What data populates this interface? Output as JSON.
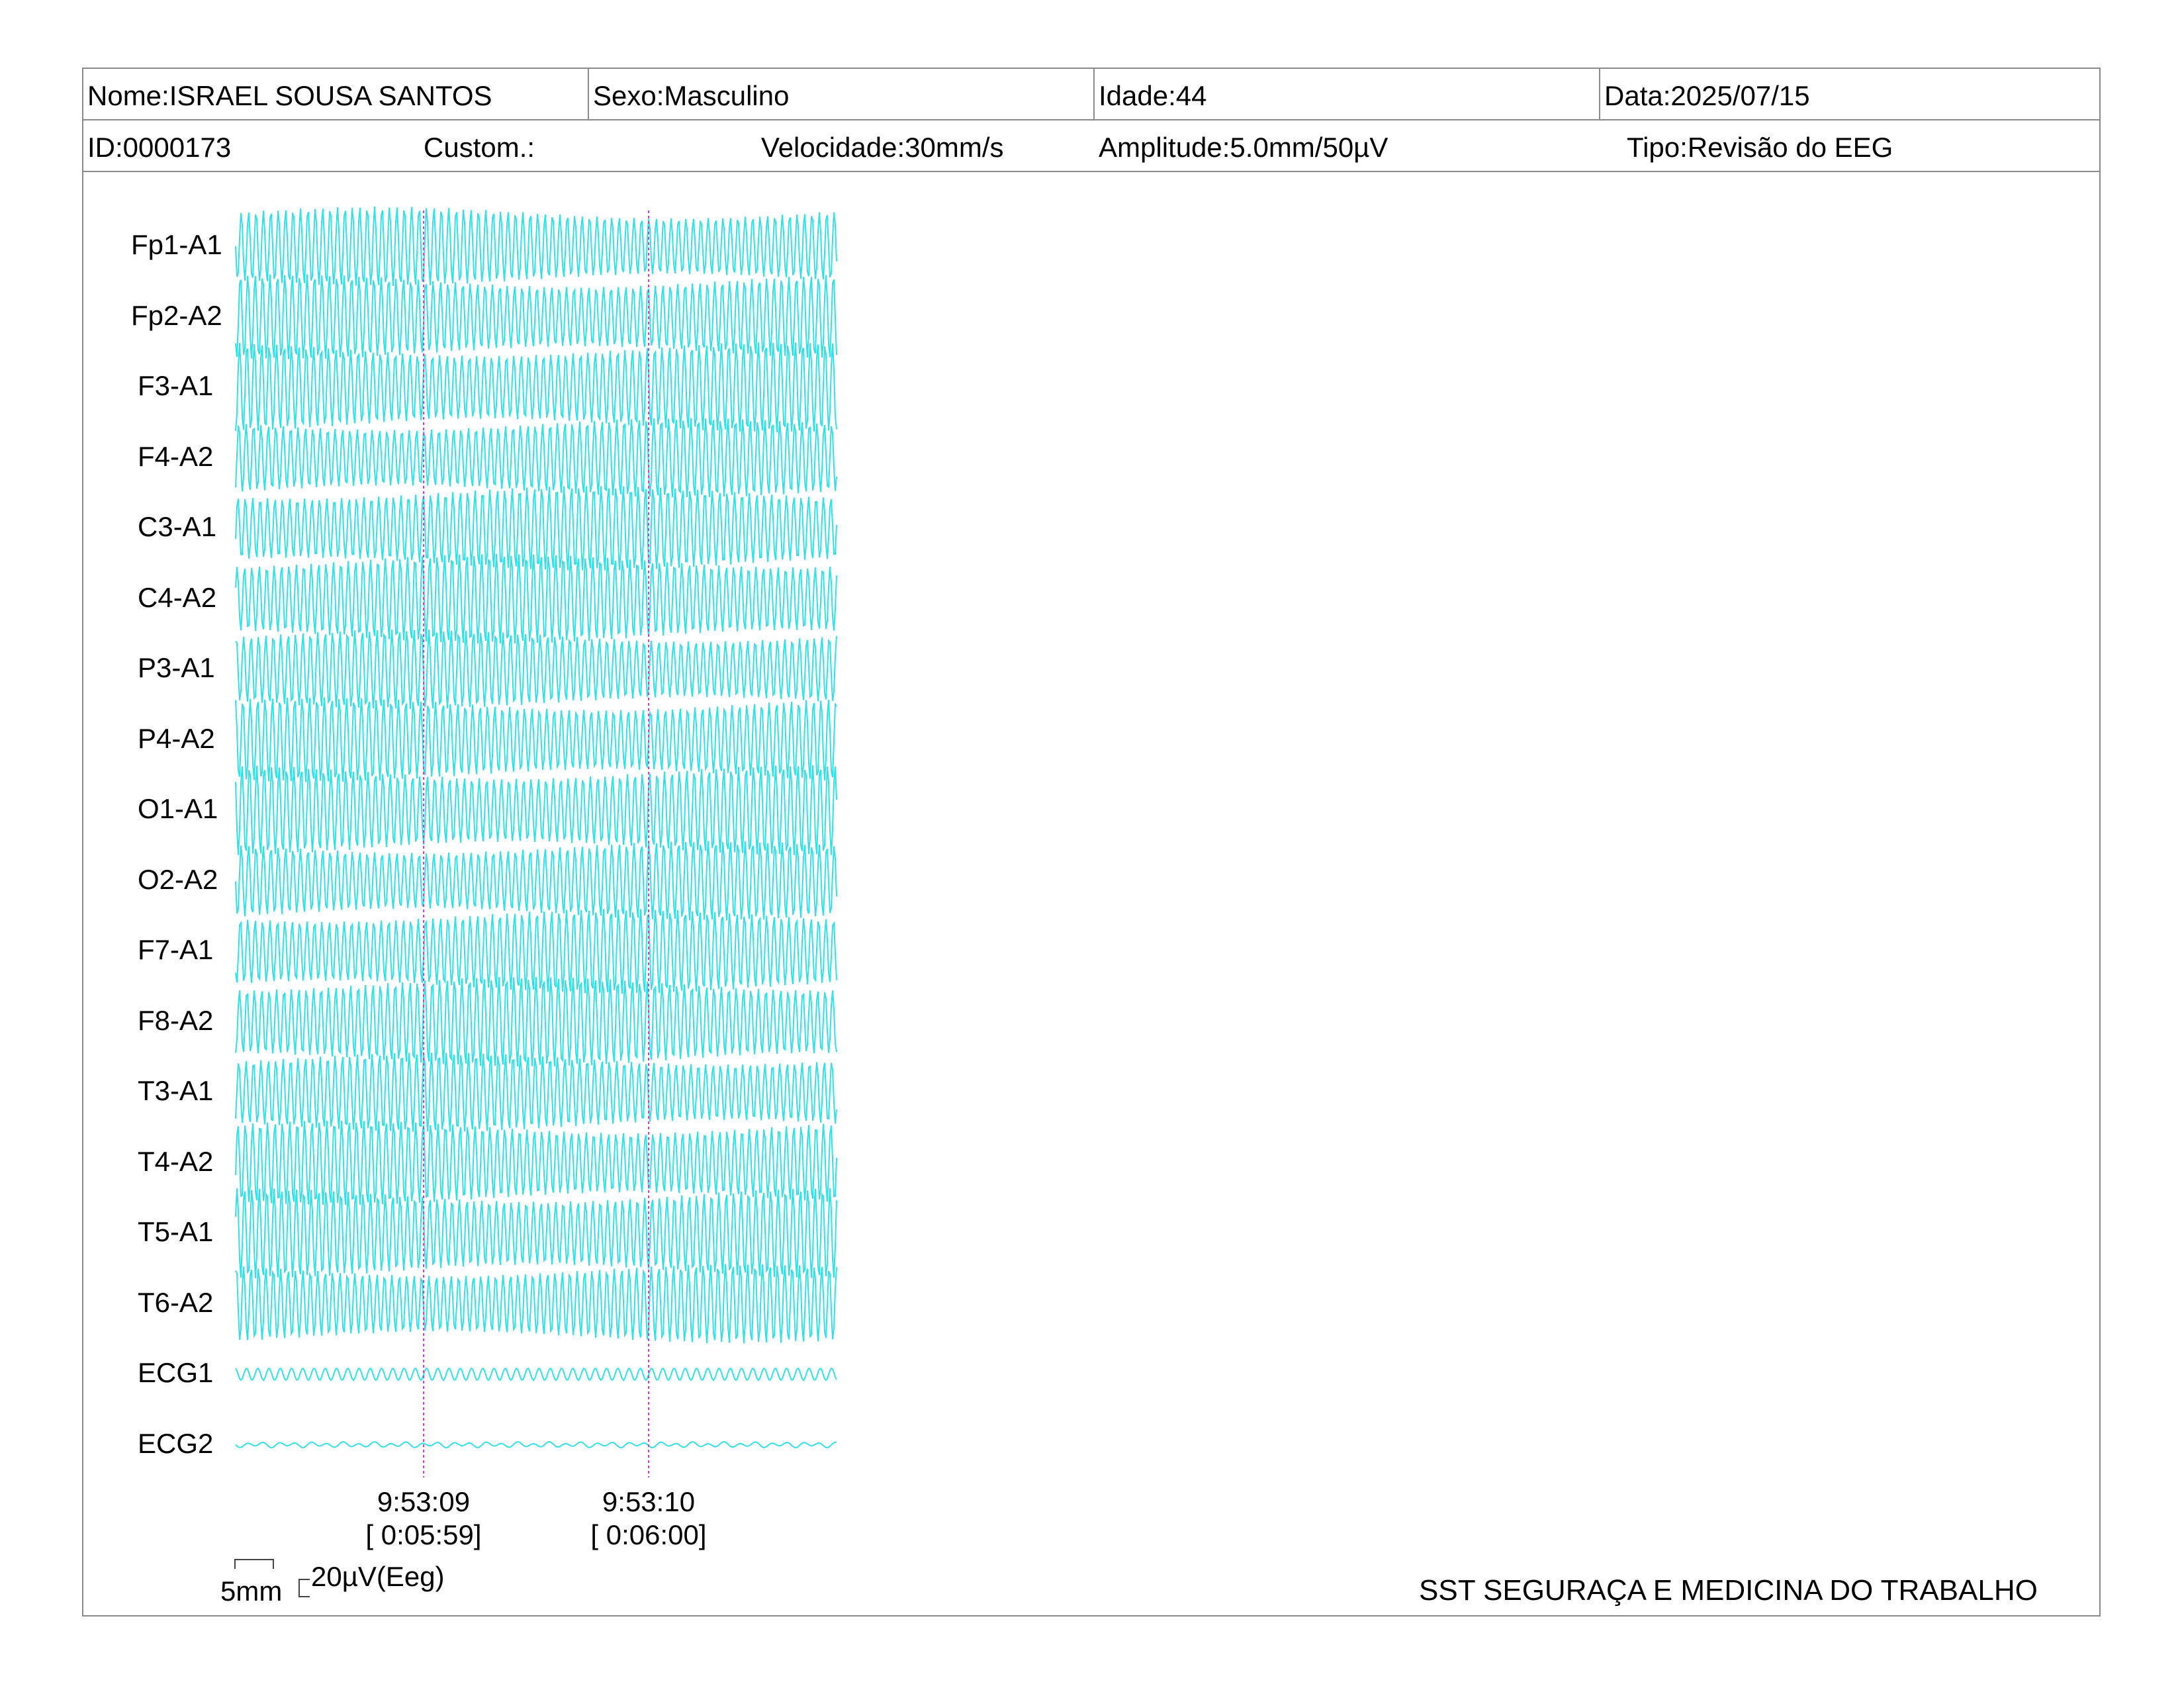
{
  "header": {
    "name": "Nome:ISRAEL SOUSA SANTOS",
    "sex": "Sexo:Masculino",
    "age": "Idade:44",
    "date": "Data:2025/07/15",
    "id": "ID:0000173",
    "custom": "Custom.:",
    "speed": "Velocidade:30mm/s",
    "amplitude": "Amplitude:5.0mm/50µV",
    "type": "Tipo:Revisão do EEG"
  },
  "leads": [
    "Fp1-A1",
    "Fp2-A2",
    "F3-A1",
    "F4-A2",
    "C3-A1",
    "C4-A2",
    "P3-A1",
    "P4-A2",
    "O1-A1",
    "O2-A2",
    "F7-A1",
    "F8-A2",
    "T3-A1",
    "T4-A2",
    "T5-A1",
    "T6-A2",
    "ECG1",
    "ECG2"
  ],
  "time_markers": [
    {
      "time": "9:53:09",
      "elapsed": "[ 0:05:59]"
    },
    {
      "time": "9:53:10",
      "elapsed": "[ 0:06:00]"
    }
  ],
  "scale": {
    "time": "5mm",
    "amplitude": "20µV(Eeg)"
  },
  "footer": {
    "organization": "SST SEGURAÇA E MEDICINA DO TRABALHO"
  },
  "colors": {
    "trace": "#33e0e6",
    "marker": "#cc44cc",
    "border": "#8a8a8a"
  }
}
